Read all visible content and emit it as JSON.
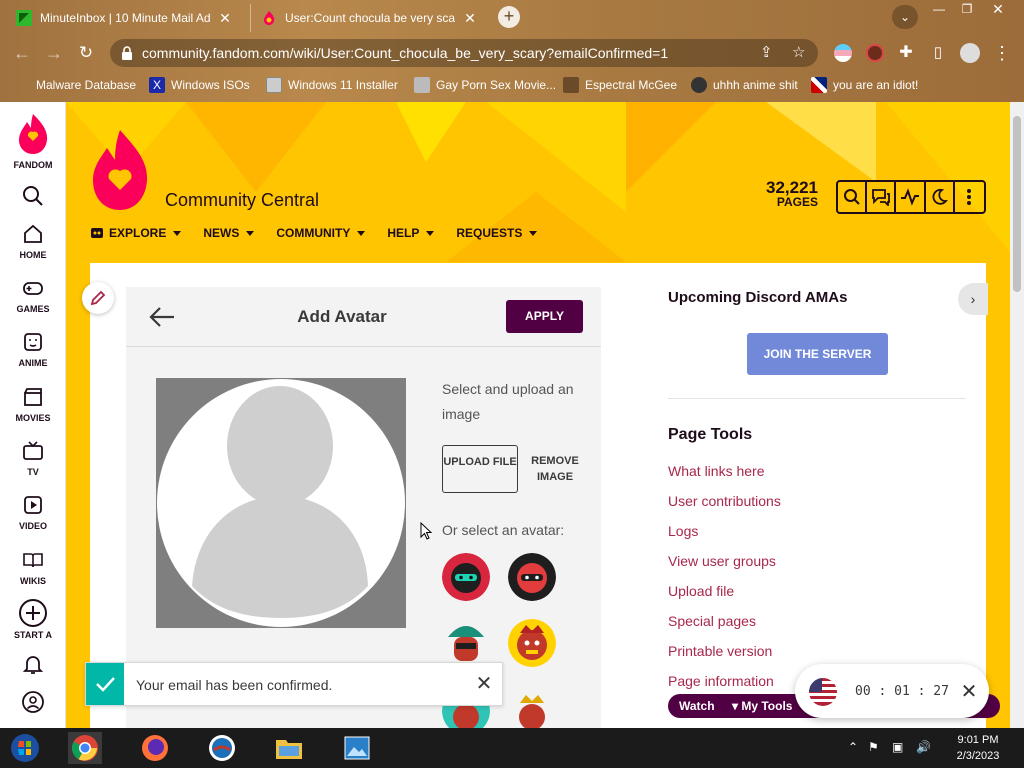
{
  "browser": {
    "tabs": [
      {
        "title": "MinuteInbox | 10 Minute Mail Ad",
        "active": false
      },
      {
        "title": "User:Count chocula be very scary",
        "active": true
      }
    ],
    "new_tab": "+",
    "url": "community.fandom.com/wiki/User:Count_chocula_be_very_scary?emailConfirmed=1",
    "bookmarks": [
      "Malware Database",
      "Windows ISOs",
      "Windows 11 Installer",
      "Gay Porn Sex Movie...",
      "Espectral McGee",
      "uhhh anime shit",
      "you are an idiot!"
    ]
  },
  "rail": {
    "brand": "FANDOM",
    "items": [
      "HOME",
      "GAMES",
      "ANIME",
      "MOVIES",
      "TV",
      "VIDEO",
      "WIKIS",
      "START A"
    ]
  },
  "wiki": {
    "name": "Community Central",
    "pages_count": "32,221",
    "pages_label": "PAGES",
    "nav": [
      "EXPLORE",
      "NEWS",
      "COMMUNITY",
      "HELP",
      "REQUESTS"
    ]
  },
  "modal": {
    "title": "Add Avatar",
    "apply": "APPLY",
    "hint": "Select and upload an image",
    "upload": "UPLOAD FILE",
    "remove": "REMOVE IMAGE",
    "or_select": "Or select an avatar:"
  },
  "sidebar": {
    "discord_title": "Upcoming Discord AMAs",
    "discord_button": "JOIN THE SERVER",
    "page_tools_title": "Page Tools",
    "links": [
      "What links here",
      "User contributions",
      "Logs",
      "View user groups",
      "Upload file",
      "Special pages",
      "Printable version",
      "Page information"
    ]
  },
  "toast": {
    "message": "Your email has been confirmed."
  },
  "page_bar": {
    "watch": "Watch",
    "my_tools": "My Tools"
  },
  "timer": {
    "display": "00 : 01 : 27"
  },
  "taskbar": {
    "time": "9:01 PM",
    "date": "2/3/2023"
  },
  "colors": {
    "fandom_yellow": "#ffc500",
    "fandom_purple": "#520044",
    "link": "#a9274b",
    "discord": "#7289da",
    "toast_green": "#00b7a8"
  }
}
